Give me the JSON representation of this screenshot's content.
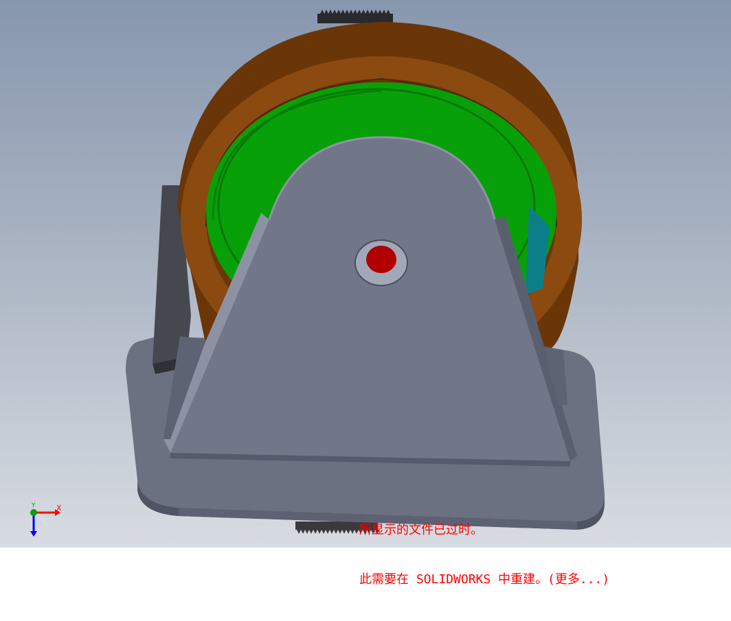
{
  "rebuild_warning": {
    "line1": "所显示的文件已过时。",
    "line2": "此需要在 SOLIDWORKS 中重建。(更多...)"
  },
  "triad": {
    "x_label": "X",
    "y_label": "Y",
    "x_color": "#ff0000",
    "y_color": "#00a000",
    "z_color": "#0000ff"
  },
  "colors": {
    "viewport_top": "#8797ae",
    "viewport_bottom": "#d8dce2",
    "tire": "#8b4a10",
    "tire_dark": "#6a3608",
    "hub": "#07a007",
    "hub_dark": "#067806",
    "axle": "#b00000",
    "bracket": "#717789",
    "bracket_dark": "#5a5f70",
    "base_plate": "#6e7384"
  }
}
